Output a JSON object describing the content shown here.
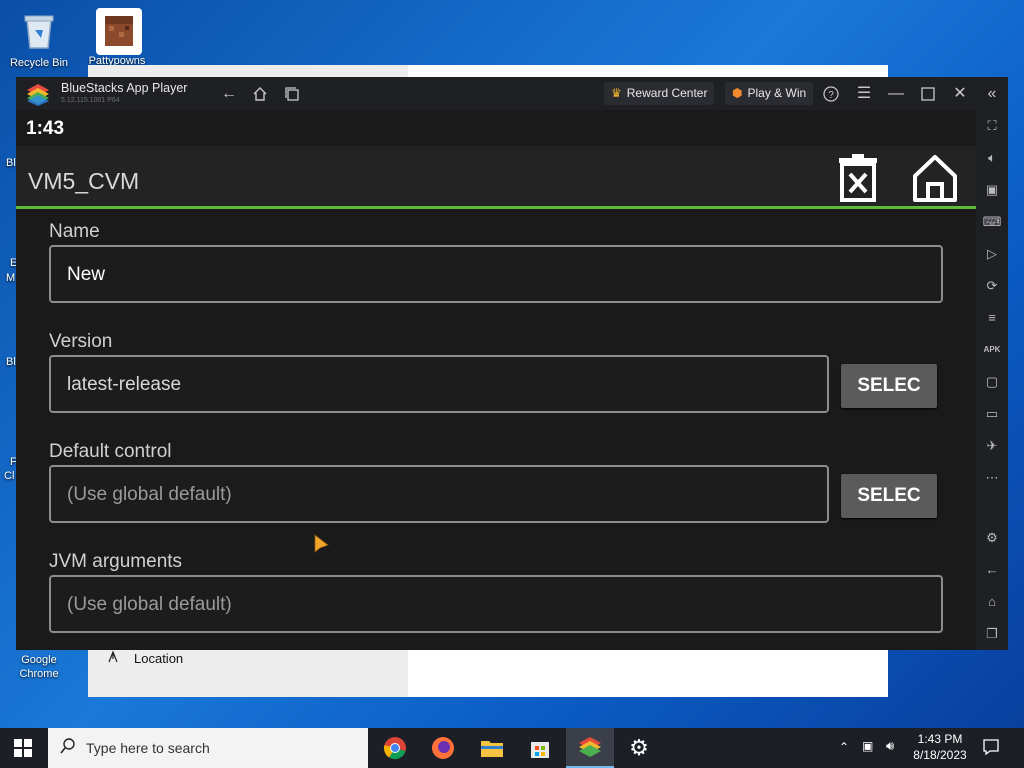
{
  "desktop": {
    "icons": [
      {
        "label": "Recycle Bin"
      },
      {
        "label": "Pattypowns"
      },
      {
        "label": "Google Chrome"
      }
    ],
    "fragments": [
      "Bl",
      "E",
      "M",
      "Bl",
      "F",
      "Cl"
    ]
  },
  "background_window": {
    "nav_item": "Location"
  },
  "bluestacks": {
    "title": "BlueStacks App Player",
    "version": "5.12.115.1001 P64",
    "reward_center": "Reward Center",
    "play_win": "Play & Win",
    "colors": {
      "accent_green": "#5dba3b",
      "window_bg": "#1f2024"
    }
  },
  "app": {
    "status_time": "1:43",
    "header_title": "VM5_CVM",
    "fields": {
      "name": {
        "label": "Name",
        "value": "New"
      },
      "version": {
        "label": "Version",
        "value": "latest-release",
        "button": "SELEC"
      },
      "control": {
        "label": "Default control",
        "placeholder": "(Use global default)",
        "button": "SELEC"
      },
      "jvm": {
        "label": "JVM arguments",
        "placeholder": "(Use global default)"
      }
    }
  },
  "taskbar": {
    "search_placeholder": "Type here to search",
    "time": "1:43 PM",
    "date": "8/18/2023"
  }
}
